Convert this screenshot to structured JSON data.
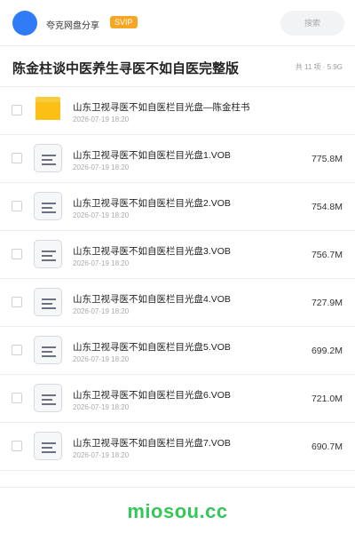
{
  "header": {
    "user_name": "夸克网盘分享",
    "badge": "SVIP",
    "search_placeholder": "搜索"
  },
  "share": {
    "title": "陈金柱谈中医养生寻医不如自医完整版",
    "summary": "共 11 项 · 5.9G"
  },
  "files": [
    {
      "type": "folder",
      "name": "山东卫视寻医不如自医栏目光盘—陈金柱书",
      "date": "2026-07-19 18:20",
      "size": ""
    },
    {
      "type": "file",
      "name": "山东卫视寻医不如自医栏目光盘1.VOB",
      "date": "2026-07-19 18:20",
      "size": "775.8M"
    },
    {
      "type": "file",
      "name": "山东卫视寻医不如自医栏目光盘2.VOB",
      "date": "2026-07-19 18:20",
      "size": "754.8M"
    },
    {
      "type": "file",
      "name": "山东卫视寻医不如自医栏目光盘3.VOB",
      "date": "2026-07-19 18:20",
      "size": "756.7M"
    },
    {
      "type": "file",
      "name": "山东卫视寻医不如自医栏目光盘4.VOB",
      "date": "2026-07-19 18:20",
      "size": "727.9M"
    },
    {
      "type": "file",
      "name": "山东卫视寻医不如自医栏目光盘5.VOB",
      "date": "2026-07-19 18:20",
      "size": "699.2M"
    },
    {
      "type": "file",
      "name": "山东卫视寻医不如自医栏目光盘6.VOB",
      "date": "2026-07-19 18:20",
      "size": "721.0M"
    },
    {
      "type": "file",
      "name": "山东卫视寻医不如自医栏目光盘7.VOB",
      "date": "2026-07-19 18:20",
      "size": "690.7M"
    }
  ],
  "footer": {
    "watermark": "miosou.cc"
  },
  "colors": {
    "accent": "#2f7cf6",
    "badge": "#f5a623",
    "folder": "#fbbf15",
    "watermark": "#34c759"
  }
}
